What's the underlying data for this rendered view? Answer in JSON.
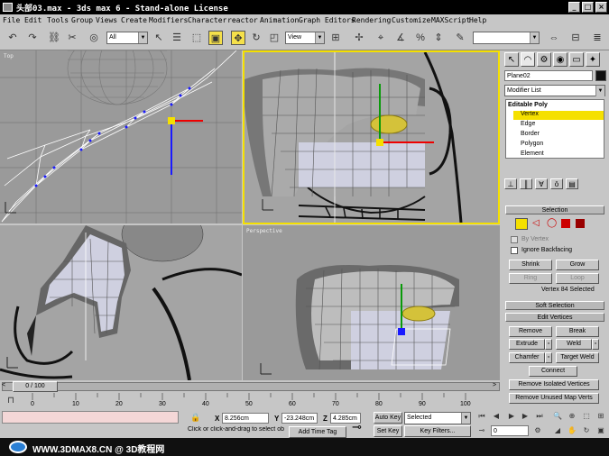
{
  "window": {
    "title": "头部03.max - 3ds max 6 - Stand-alone License"
  },
  "menu": [
    "File",
    "Edit",
    "Tools",
    "Group",
    "Views",
    "Create",
    "Modifiers",
    "Character",
    "reactor",
    "Animation",
    "Graph Editors",
    "Rendering",
    "Customize",
    "MAXScript",
    "Help"
  ],
  "toolbar": {
    "selection_filter": "All",
    "ref_coord": "View"
  },
  "viewports": {
    "top_label": "Top",
    "persp_label": "Perspective"
  },
  "panel": {
    "object_name": "Plane02",
    "modifier_list": "Modifier List",
    "stack": [
      "Editable Poly",
      "Vertex",
      "Edge",
      "Border",
      "Polygon",
      "Element"
    ],
    "selection": {
      "title": "Selection",
      "by_vertex": "By Vertex",
      "ignore_backfacing": "Ignore Backfacing",
      "shrink": "Shrink",
      "grow": "Grow",
      "ring": "Ring",
      "loop": "Loop",
      "status": "Vertex 84 Selected"
    },
    "soft_selection": "Soft Selection",
    "edit_vertices": {
      "title": "Edit Vertices",
      "remove": "Remove",
      "break": "Break",
      "extrude": "Extrude",
      "weld": "Weld",
      "chamfer": "Chamfer",
      "target_weld": "Target Weld",
      "connect": "Connect",
      "remove_isolated": "Remove Isolated Vertices",
      "remove_unused": "Remove Unused Map Verts"
    }
  },
  "timeline": {
    "frame": "0 / 100",
    "ticks": [
      "0",
      "10",
      "20",
      "30",
      "40",
      "50",
      "60",
      "70",
      "80",
      "90",
      "100"
    ]
  },
  "status": {
    "x_label": "X",
    "x": "8.256cm",
    "y_label": "Y",
    "y": "-23.248cm",
    "z_label": "Z",
    "z": "4.285cm",
    "prompt": "Click or click-and-drag to select ob",
    "add_time_tag": "Add Time Tag",
    "auto_key": "Auto Key",
    "set_key": "Set Key",
    "key_mode": "Selected",
    "key_filters": "Key Filters...",
    "frame": "0"
  },
  "footer": {
    "text": "WWW.3DMAX8.CN @ 3D教程网"
  },
  "colors": {
    "selection_yellow": "#f5e000",
    "viewport_bg": "#9a9a9a"
  }
}
